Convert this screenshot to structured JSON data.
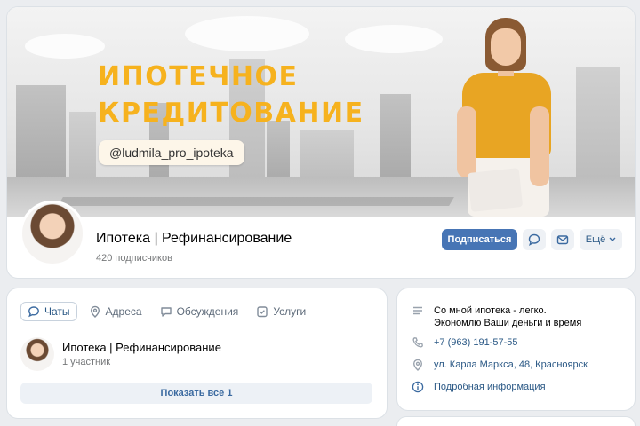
{
  "cover": {
    "title_line1": "ИПОТЕЧНОЕ",
    "title_line2": "КРЕДИТОВАНИЕ",
    "handle": "@ludmila_pro_ipoteka"
  },
  "group": {
    "name": "Ипотека | Рефинансирование",
    "subscribers": "420 подписчиков"
  },
  "actions": {
    "subscribe": "Подписаться",
    "more": "Ещё"
  },
  "tabs": [
    {
      "label": "Чаты",
      "icon": "chat-icon",
      "active": true
    },
    {
      "label": "Адреса",
      "icon": "location-icon",
      "active": false
    },
    {
      "label": "Обсуждения",
      "icon": "discussion-icon",
      "active": false
    },
    {
      "label": "Услуги",
      "icon": "services-icon",
      "active": false
    }
  ],
  "chat": {
    "title": "Ипотека | Рефинансирование",
    "members": "1 участник"
  },
  "show_all": "Показать все 1",
  "info": {
    "description_line1": "Со мной ипотека - легко.",
    "description_line2": "Экономлю Ваши деньги и время",
    "phone": "+7 (963) 191-57-55",
    "address": "ул. Карла Маркса, 48, Красноярск",
    "details": "Подробная информация"
  },
  "colors": {
    "accent": "#4775b5",
    "link": "#2a5885",
    "cover_title": "#f6b21e",
    "shirt": "#e8a523"
  }
}
